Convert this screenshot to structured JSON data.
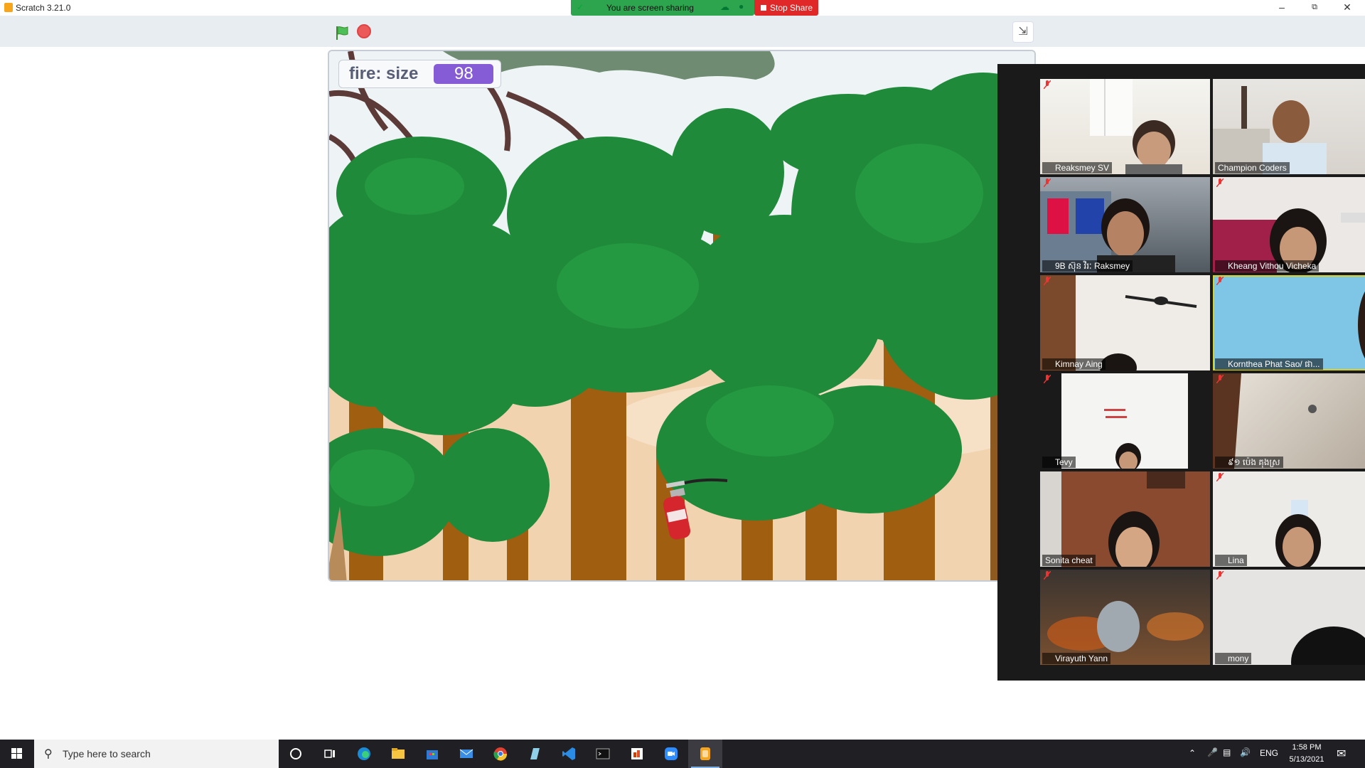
{
  "window": {
    "title": "Scratch 3.21.0",
    "minimize_icon": "minimize-icon",
    "restore_icon": "restore-icon",
    "close_icon": "close-icon"
  },
  "screen_share": {
    "status": "You are screen sharing",
    "stop_label": "Stop Share",
    "accent": "#2da44e",
    "stop_color": "#e02828"
  },
  "scratch": {
    "green_flag_icon": "green-flag-icon",
    "stop_icon": "stop-sign-icon",
    "fullscreen_icon": "exit-fullscreen-icon",
    "monitor": {
      "label": "fire: size",
      "value": "98"
    },
    "sprite": "fire-extinguisher"
  },
  "zoom_gallery": {
    "participants": [
      {
        "name": "Reaksmey SV",
        "muted": true
      },
      {
        "name": "Champion Coders",
        "muted": false
      },
      {
        "name": "9B ស៊ុន វិរៈ Raksmey",
        "muted": true
      },
      {
        "name": "Kheang Vithou Vicheka",
        "muted": true
      },
      {
        "name": "Kimnay Aing",
        "muted": true
      },
      {
        "name": "Kornthea Phat Sao/ ផា...",
        "muted": true,
        "active": true
      },
      {
        "name": "Tevy",
        "muted": true
      },
      {
        "name": "៩១ ប៉េង គុងស្រ",
        "muted": true
      },
      {
        "name": "Sonita cheat",
        "muted": false
      },
      {
        "name": "Lina",
        "muted": true
      },
      {
        "name": "Virayuth Yann",
        "muted": true
      },
      {
        "name": "mony",
        "muted": true
      }
    ]
  },
  "taskbar": {
    "search_placeholder": "Type here to search",
    "language": "ENG",
    "time": "1:58 PM",
    "date": "5/13/2021",
    "apps": [
      "cortana",
      "task-view",
      "edge",
      "file-explorer",
      "store",
      "mail",
      "chrome",
      "notepad",
      "vscode",
      "terminal",
      "office",
      "zoom",
      "scratch"
    ]
  }
}
